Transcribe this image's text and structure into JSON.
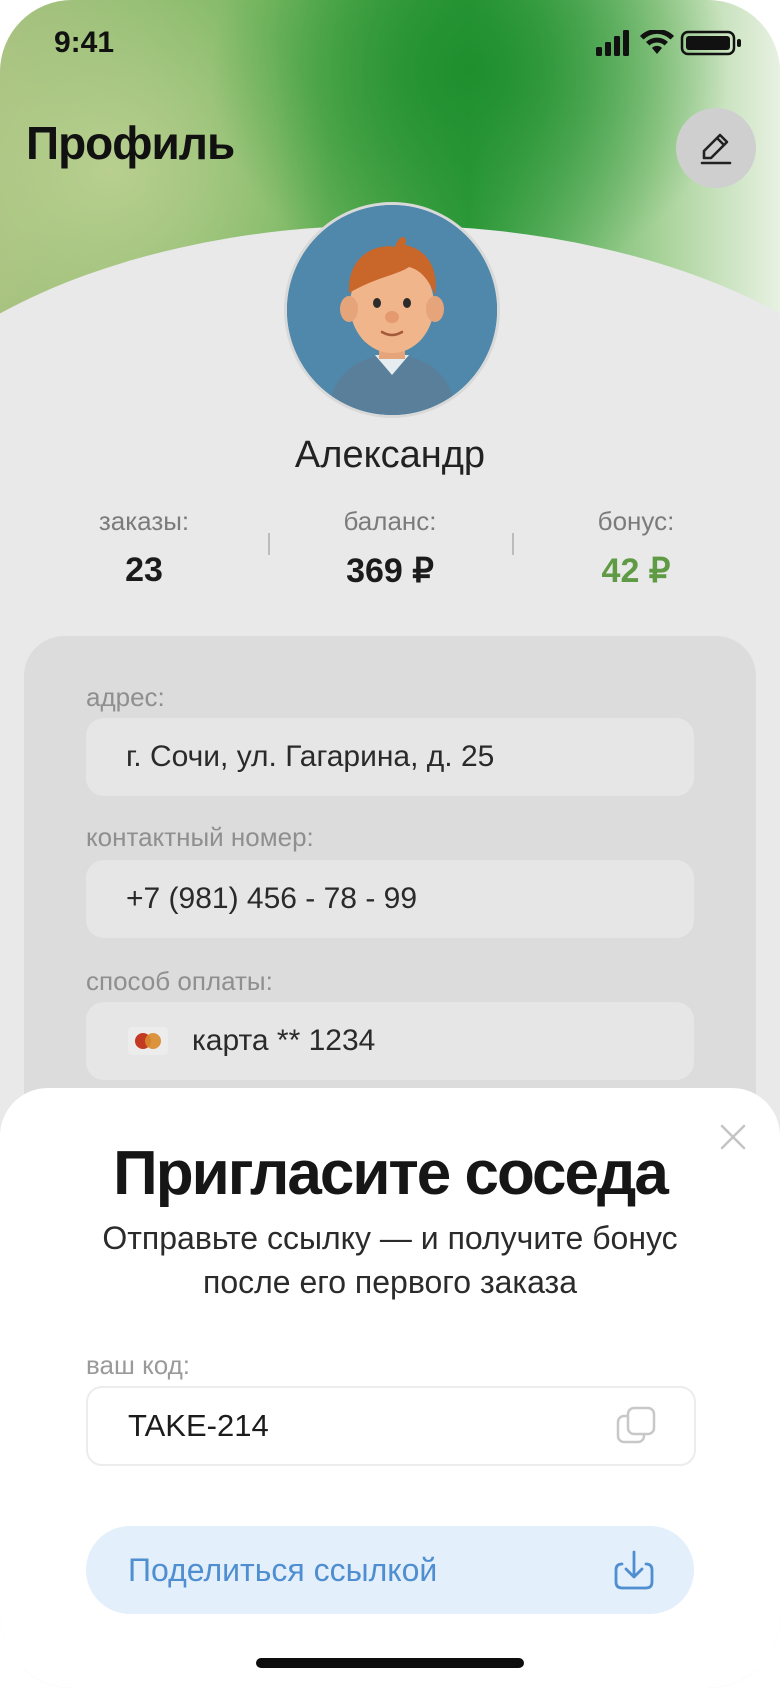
{
  "status_bar": {
    "time": "9:41"
  },
  "header": {
    "title": "Профиль"
  },
  "profile": {
    "name": "Александр",
    "stats": [
      {
        "label": "заказы:",
        "value": "23",
        "color": "#1b1b1b"
      },
      {
        "label": "баланс:",
        "value": "369 ₽",
        "color": "#1b1b1b"
      },
      {
        "label": "бонус:",
        "value": "42 ₽",
        "color": "#5f9a45"
      }
    ]
  },
  "details": {
    "address": {
      "label": "адрес:",
      "value": "г. Сочи, ул. Гагарина, д. 25"
    },
    "phone": {
      "label": "контактный номер:",
      "value": "+7 (981) 456 - 78 - 99"
    },
    "payment": {
      "label": "способ оплаты:",
      "value": "карта ** 1234",
      "icon": "mastercard-icon"
    }
  },
  "invite_sheet": {
    "title": "Пригласите соседа",
    "subtitle_line1": "Отправьте ссылку — и получите бонус",
    "subtitle_line2": "после его первого заказа",
    "code_label": "ваш код:",
    "code": "TAKE-214",
    "share_label": "Поделиться ссылкой",
    "accent_color": "#4f8ed0"
  },
  "icons": [
    "edit-pencil-icon",
    "close-icon",
    "copy-icon",
    "share-download-icon",
    "signal-icon",
    "wifi-icon",
    "battery-icon"
  ]
}
